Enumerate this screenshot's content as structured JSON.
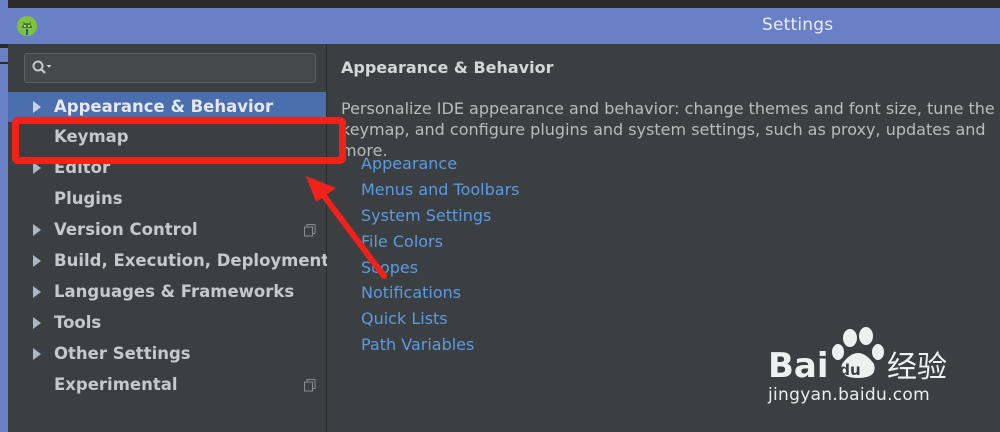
{
  "window": {
    "title": "Settings"
  },
  "search": {
    "value": "",
    "placeholder": ""
  },
  "sidebar": {
    "items": [
      {
        "label": "Appearance & Behavior",
        "expandable": true,
        "selected": true,
        "project_icon": false
      },
      {
        "label": "Keymap",
        "expandable": false,
        "selected": false,
        "project_icon": false
      },
      {
        "label": "Editor",
        "expandable": true,
        "selected": false,
        "project_icon": false
      },
      {
        "label": "Plugins",
        "expandable": false,
        "selected": false,
        "project_icon": false
      },
      {
        "label": "Version Control",
        "expandable": true,
        "selected": false,
        "project_icon": true
      },
      {
        "label": "Build, Execution, Deployment",
        "expandable": true,
        "selected": false,
        "project_icon": false
      },
      {
        "label": "Languages & Frameworks",
        "expandable": true,
        "selected": false,
        "project_icon": false
      },
      {
        "label": "Tools",
        "expandable": true,
        "selected": false,
        "project_icon": false
      },
      {
        "label": "Other Settings",
        "expandable": true,
        "selected": false,
        "project_icon": false
      },
      {
        "label": "Experimental",
        "expandable": false,
        "selected": false,
        "project_icon": true
      }
    ]
  },
  "main": {
    "heading": "Appearance & Behavior",
    "description": "Personalize IDE appearance and behavior: change themes and font size, tune the keymap, and configure plugins and system settings, such as proxy, updates and more.",
    "links": [
      "Appearance",
      "Menus and Toolbars",
      "System Settings",
      "File Colors",
      "Scopes",
      "Notifications",
      "Quick Lists",
      "Path Variables"
    ]
  },
  "watermark": {
    "brand": "Baidu经验",
    "url": "jingyan.baidu.com"
  },
  "colors": {
    "titlebar": "#6980c7",
    "panel": "#3c3f41",
    "selection": "#4b6eaf",
    "link": "#5a9be3",
    "annotation": "#f0221a"
  },
  "icons": {
    "app": "android-studio-icon",
    "search": "search-icon",
    "expand": "triangle-right-icon",
    "project_scope": "project-scope-icon"
  }
}
